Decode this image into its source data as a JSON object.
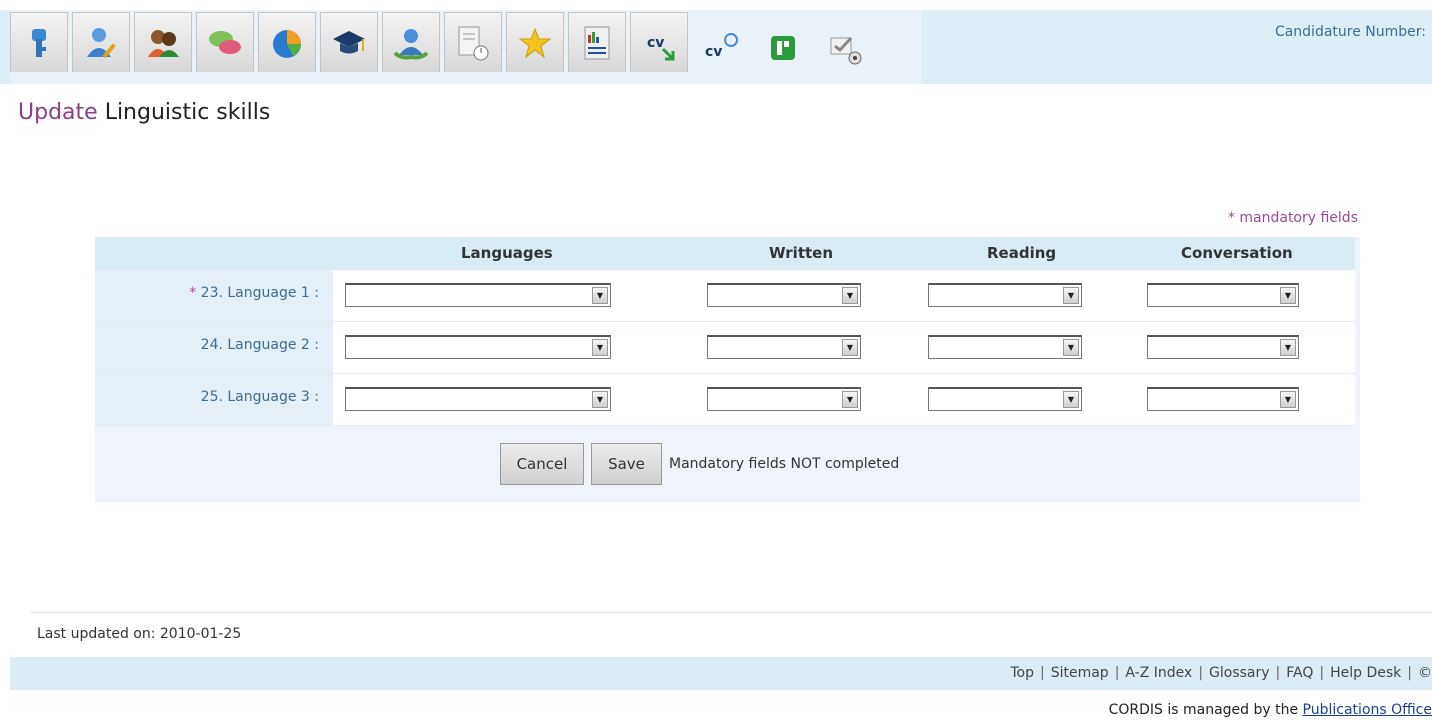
{
  "toolbar": {
    "icons": [
      "key-icon",
      "edit-person-icon",
      "contacts-icon",
      "chat-icon",
      "pie-chart-icon",
      "graduation-cap-icon",
      "award-person-icon",
      "document-clock-icon",
      "star-icon",
      "report-icon",
      "cv-export-icon",
      "cv-search-icon",
      "excel-icon",
      "edit-check-icon"
    ],
    "candidature_label": "Candidature Number:"
  },
  "page": {
    "title_verb": "Update",
    "title_object": "Linguistic skills",
    "mandatory_note": "* mandatory fields"
  },
  "form": {
    "headers": [
      "Languages",
      "Written",
      "Reading",
      "Conversation"
    ],
    "rows": [
      {
        "star": "* ",
        "label": "23. Language 1 :"
      },
      {
        "star": "",
        "label": "24. Language 2 :"
      },
      {
        "star": "",
        "label": "25. Language 3 :"
      }
    ],
    "cancel_label": "Cancel",
    "save_label": "Save",
    "status": "Mandatory fields NOT completed"
  },
  "footer": {
    "last_updated": "Last updated on: 2010-01-25",
    "links": [
      "Top",
      "Sitemap",
      "A-Z Index",
      "Glossary",
      "FAQ",
      "Help Desk",
      "©"
    ],
    "managed_prefix": "CORDIS is managed by the ",
    "managed_link": "Publications Office"
  },
  "colors": {
    "accent_purple": "#8a3f87",
    "link_blue": "#3d6d93",
    "header_bg": "#d9ecf6"
  }
}
